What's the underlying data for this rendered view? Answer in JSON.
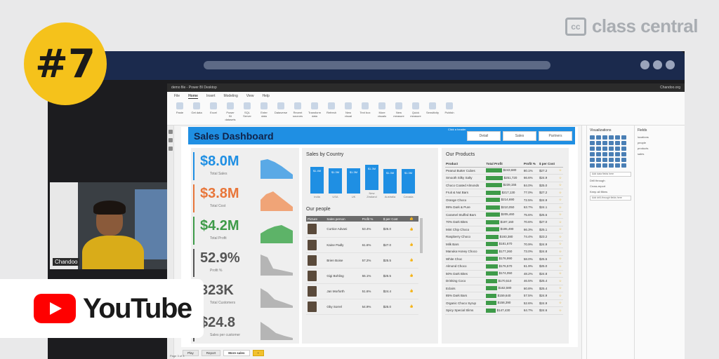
{
  "brand": {
    "name": "class central",
    "icon": "cc"
  },
  "badge": {
    "text": "#7"
  },
  "youtube": {
    "label": "YouTube"
  },
  "webcam": {
    "name": "Chandoo"
  },
  "pbi": {
    "window_title": "demo file - Power BI Desktop",
    "user": "Chandoo.org",
    "menu": [
      "File",
      "Home",
      "Insert",
      "Modeling",
      "View",
      "Help"
    ],
    "ribbon": [
      "Paste",
      "Get data",
      "Excel",
      "Power BI datasets",
      "SQL Server",
      "Enter data",
      "Dataverse",
      "Recent sources",
      "Transform data",
      "Refresh",
      "New visual",
      "Text box",
      "More visuals",
      "New measure",
      "Quick measure",
      "Sensitivity",
      "Publish"
    ],
    "dashboard_title": "Sales Dashboard",
    "nav_hint": "Click a header",
    "nav": [
      "Detail",
      "Sales",
      "Partners"
    ],
    "kpis": [
      {
        "value": "$8.0M",
        "label": "Total Sales",
        "color": "#1f8fe3"
      },
      {
        "value": "$3.8M",
        "label": "Total Cost",
        "color": "#e8763a"
      },
      {
        "value": "$4.2M",
        "label": "Total Profit",
        "color": "#3e9b49"
      },
      {
        "value": "52.9%",
        "label": "Profit %",
        "color": "#555555"
      },
      {
        "value": "323K",
        "label": "Total Customers",
        "color": "#555555"
      },
      {
        "value": "$24.8",
        "label": "Sales per customer",
        "color": "#555555"
      }
    ],
    "sales_by_country": {
      "title": "Sales by Country",
      "categories": [
        "India",
        "USA",
        "UK",
        "New Zealand",
        "Australia",
        "Canada"
      ],
      "values": [
        "$1.4M",
        "$1.3M",
        "$1.3M",
        "$1.3M",
        "$1.3M",
        "$1.3M"
      ],
      "heights": [
        1.4,
        1.33,
        1.33,
        1.33,
        1.3,
        1.3
      ]
    },
    "people": {
      "title": "Our people",
      "headers": [
        "Picture",
        "Sales person",
        "Profit %",
        "$ per Cost"
      ],
      "rows": [
        [
          "Curtice Advani",
          "53.4%",
          "$25.0"
        ],
        [
          "Kaine Padly",
          "61.6%",
          "$27.0"
        ],
        [
          "Brien Boise",
          "57.2%",
          "$25.5"
        ],
        [
          "Gigi Bohling",
          "55.1%",
          "$25.5"
        ],
        [
          "Jan Morforth",
          "51.6%",
          "$24.4"
        ],
        [
          "Oby Sorrel",
          "54.9%",
          "$25.0"
        ]
      ]
    },
    "products": {
      "title": "Our Products",
      "headers": [
        "Product",
        "Total Profit",
        "Profit %",
        "$ per Cost"
      ],
      "rows": [
        [
          "Peanut Butter Cubes",
          "$243,680",
          "80.1%",
          "$27.2"
        ],
        [
          "Smooth Silky Salty",
          "$251,720",
          "66.6%",
          "$24.9"
        ],
        [
          "Choco Coated Almonds",
          "$239,155",
          "84.0%",
          "$25.0"
        ],
        [
          "Fruit & Nut Bars",
          "$217,130",
          "77.0%",
          "$27.2"
        ],
        [
          "Orange Choco",
          "$214,690",
          "72.5%",
          "$24.9"
        ],
        [
          "99% Dark & Pure",
          "$210,050",
          "63.7%",
          "$24.1"
        ],
        [
          "Caramel Stuffed Bars",
          "$205,460",
          "75.6%",
          "$25.6"
        ],
        [
          "70% Dark Bites",
          "$197,160",
          "70.6%",
          "$27.0"
        ],
        [
          "Mint Chip Choco",
          "$195,490",
          "66.3%",
          "$25.1"
        ],
        [
          "Raspberry Choco",
          "$193,380",
          "74.4%",
          "$23.2"
        ],
        [
          "Milk Bars",
          "$181,670",
          "70.9%",
          "$24.9"
        ],
        [
          "Manuka Honey Choco",
          "$177,260",
          "73.0%",
          "$24.8"
        ],
        [
          "White Choc",
          "$176,990",
          "58.0%",
          "$25.5"
        ],
        [
          "Almond Choco",
          "$176,570",
          "61.9%",
          "$25.0"
        ],
        [
          "50% Dark Bites",
          "$174,050",
          "48.2%",
          "$24.8"
        ],
        [
          "Drinking Coco",
          "$170,510",
          "46.5%",
          "$25.4"
        ],
        [
          "Eclairs",
          "$162,580",
          "60.8%",
          "$25.4"
        ],
        [
          "85% Dark Bars",
          "$159,640",
          "57.5%",
          "$24.9"
        ],
        [
          "Organic Choco Syrup",
          "$158,390",
          "52.6%",
          "$24.9"
        ],
        [
          "Spicy Special Slims",
          "$147,430",
          "64.7%",
          "$24.6"
        ]
      ]
    },
    "panes": {
      "visualizations": "Visualizations",
      "fields": "Fields",
      "filters": "Filters",
      "drill": "Drill through",
      "cross_report": "Cross-report",
      "keep_filters": "Keep all filters",
      "add_fields": "Add data fields here",
      "add_drill": "Add drill-through fields here",
      "tables": [
        "locations",
        "people",
        "products",
        "sales"
      ]
    },
    "pages": [
      "Play",
      "Report",
      "More sales"
    ],
    "page_status": "Page 3 of 3"
  }
}
